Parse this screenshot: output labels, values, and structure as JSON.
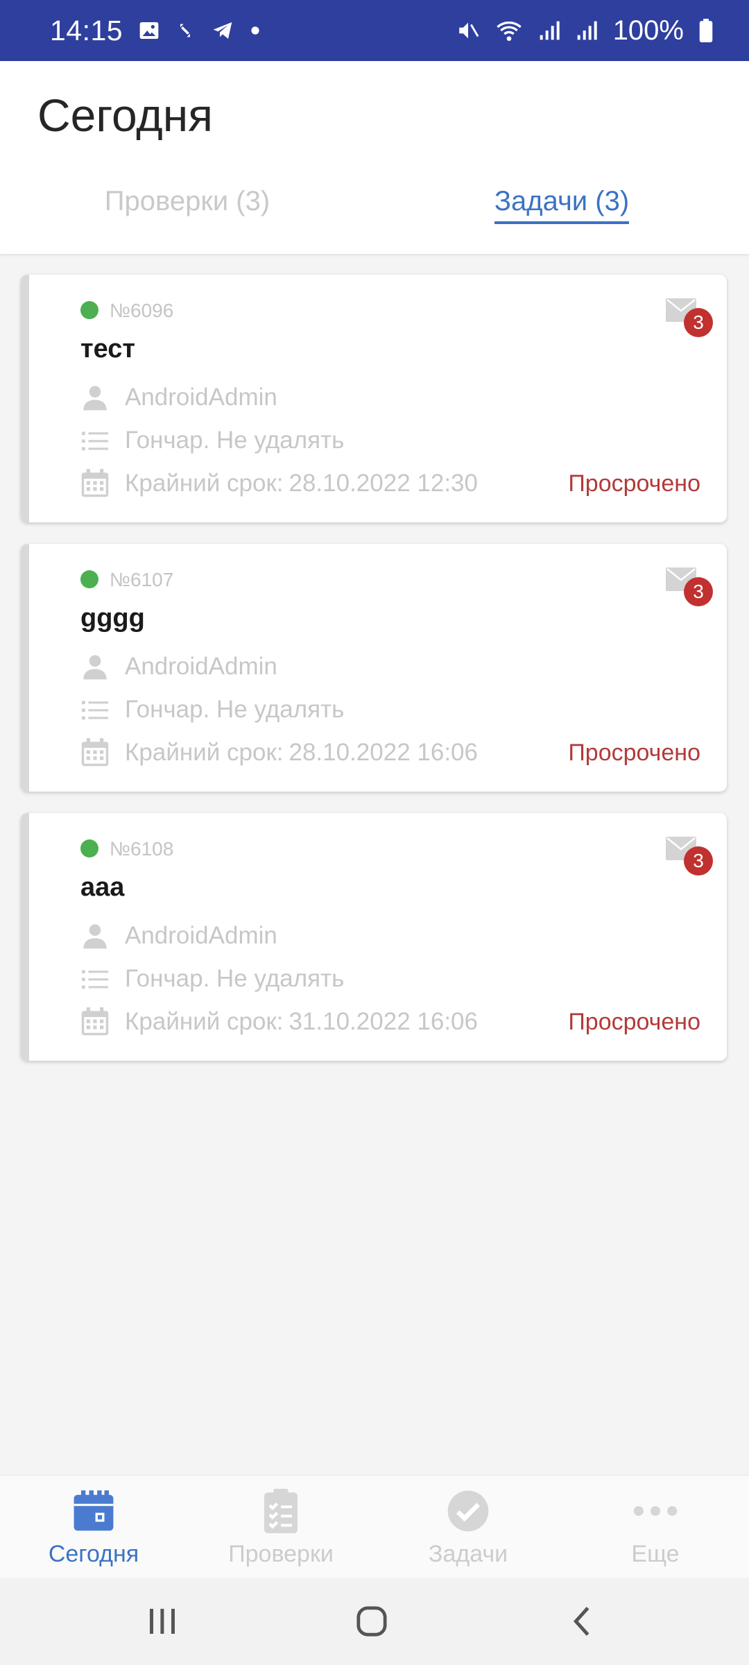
{
  "status_bar": {
    "time": "14:15",
    "battery": "100%",
    "icons_left": [
      "image-icon",
      "sync-icon",
      "telegram-icon",
      "dot-icon"
    ],
    "icons_right": [
      "mute-icon",
      "wifi-icon",
      "signal-icon",
      "signal-icon",
      "battery-icon"
    ]
  },
  "header": {
    "title": "Сегодня",
    "tabs": [
      {
        "label": "Проверки (3)",
        "active": false
      },
      {
        "label": "Задачи (3)",
        "active": true
      }
    ]
  },
  "cards": [
    {
      "number": "№6096",
      "title": "тест",
      "user": "AndroidAdmin",
      "list": "Гончар. Не удалять",
      "deadline_label": "Крайний срок:",
      "deadline_value": "28.10.2022 12:30",
      "status": "Просрочено",
      "badge": "3"
    },
    {
      "number": "№6107",
      "title": "gggg",
      "user": "AndroidAdmin",
      "list": "Гончар. Не удалять",
      "deadline_label": "Крайний срок:",
      "deadline_value": "28.10.2022 16:06",
      "status": "Просрочено",
      "badge": "3"
    },
    {
      "number": "№6108",
      "title": "aaa",
      "user": "AndroidAdmin",
      "list": "Гончар. Не удалять",
      "deadline_label": "Крайний срок:",
      "deadline_value": "31.10.2022 16:06",
      "status": "Просрочено",
      "badge": "3"
    }
  ],
  "bottom_nav": [
    {
      "label": "Сегодня",
      "icon": "calendar-icon",
      "active": true
    },
    {
      "label": "Проверки",
      "icon": "checklist-icon",
      "active": false
    },
    {
      "label": "Задачи",
      "icon": "check-circle-icon",
      "active": false
    },
    {
      "label": "Еще",
      "icon": "more-icon",
      "active": false
    }
  ],
  "colors": {
    "status_bar": "#2e3f9e",
    "accent": "#3b73c4",
    "overdue": "#b33a3a",
    "badge": "#c0312f",
    "dot": "#4caf50"
  }
}
